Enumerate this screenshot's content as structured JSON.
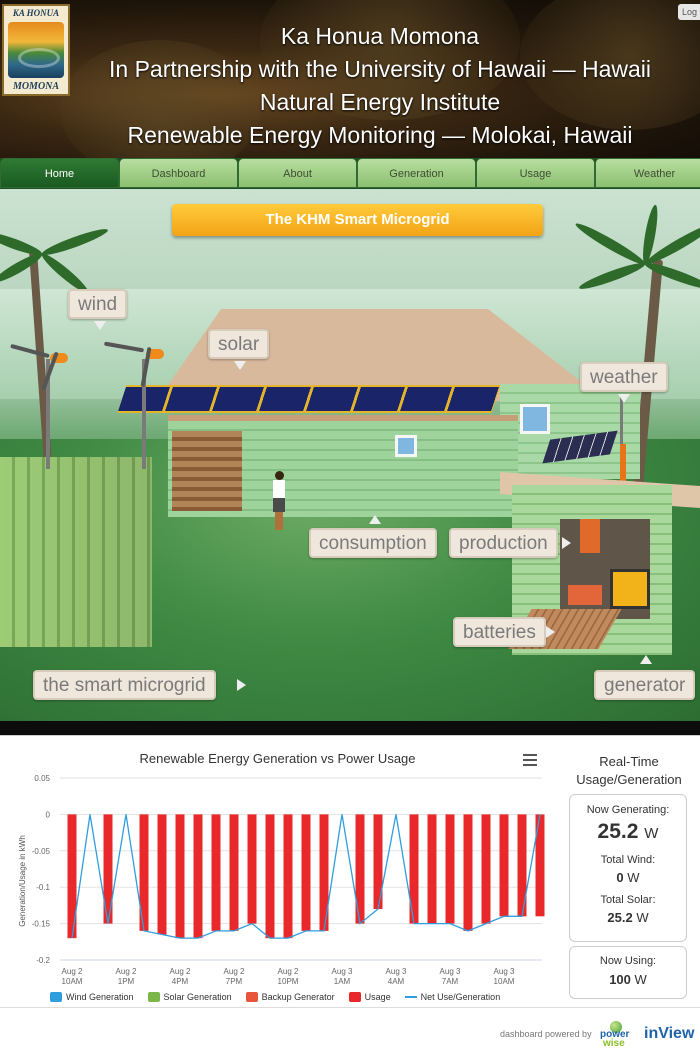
{
  "header": {
    "logo_top": "KA HONUA",
    "logo_bottom": "MOMONA",
    "lines": [
      "Ka Honua Momona",
      "In Partnership with the University of Hawaii — Hawaii",
      "Natural Energy Institute",
      "Renewable Energy Monitoring — Molokai, Hawaii"
    ],
    "login_label": "Log"
  },
  "nav": {
    "items": [
      "Home",
      "Dashboard",
      "About",
      "Generation",
      "Usage",
      "Weather"
    ],
    "active": "Home",
    "active_color": "#1f6a26",
    "inactive_color": "#a6d08c"
  },
  "scene": {
    "title": "The KHM Smart Microgrid",
    "tags": {
      "wind": "wind",
      "solar": "solar",
      "weather": "weather",
      "consumption": "consumption",
      "production": "production",
      "batteries": "batteries",
      "smart_microgrid": "the smart microgrid",
      "generator": "generator"
    }
  },
  "chart": {
    "title": "Renewable Energy Generation vs Power Usage",
    "menu_icon": "hamburger-menu-icon",
    "legend": [
      "Wind Generation",
      "Solar Generation",
      "Backup Generator",
      "Usage",
      "Net Use/Generation"
    ],
    "legend_colors": [
      "#2f9ede",
      "#7ab648",
      "#e8553a",
      "#e8282a",
      "#2f9ede"
    ]
  },
  "chart_data": {
    "type": "bar",
    "title": "Renewable Energy Generation vs Power Usage",
    "xlabel": "",
    "ylabel": "Generation/Usage in kWh",
    "ylim": [
      -0.2,
      0.05
    ],
    "yticks": [
      0.05,
      0,
      -0.05,
      -0.1,
      -0.15,
      -0.2
    ],
    "ytick_labels": [
      "0.05",
      "0",
      "-0.05",
      "-0.1",
      "-0.15",
      "-0.2"
    ],
    "xtick_labels": [
      [
        "Aug 2",
        "10AM"
      ],
      [
        "Aug 2",
        "1PM"
      ],
      [
        "Aug 2",
        "4PM"
      ],
      [
        "Aug 2",
        "7PM"
      ],
      [
        "Aug 2",
        "10PM"
      ],
      [
        "Aug 3",
        "1AM"
      ],
      [
        "Aug 3",
        "4AM"
      ],
      [
        "Aug 3",
        "7AM"
      ],
      [
        "Aug 3",
        "10AM"
      ]
    ],
    "xtick_positions": [
      0,
      3,
      6,
      9,
      12,
      15,
      18,
      21,
      24
    ],
    "grid": true,
    "legend_position": "bottom",
    "series": [
      {
        "name": "Usage",
        "color": "#e8282a",
        "values": [
          -0.17,
          0,
          -0.15,
          0,
          -0.16,
          -0.165,
          -0.17,
          -0.17,
          -0.16,
          -0.16,
          -0.15,
          -0.17,
          -0.17,
          -0.16,
          -0.16,
          0,
          -0.15,
          -0.13,
          0,
          -0.15,
          -0.15,
          -0.15,
          -0.16,
          -0.15,
          -0.14,
          -0.14,
          -0.14
        ]
      },
      {
        "name": "Net Use/Generation",
        "type": "line",
        "color": "#2f9ede",
        "values": [
          -0.17,
          0,
          -0.15,
          0,
          -0.16,
          -0.165,
          -0.17,
          -0.17,
          -0.16,
          -0.16,
          -0.15,
          -0.17,
          -0.17,
          -0.16,
          -0.16,
          0,
          -0.15,
          -0.13,
          0,
          -0.15,
          -0.15,
          -0.15,
          -0.16,
          -0.15,
          -0.14,
          -0.14,
          0
        ]
      }
    ]
  },
  "realtime": {
    "title_line1": "Real-Time",
    "title_line2": "Usage/Generation",
    "now_generating_label": "Now Generating:",
    "now_generating_value": "25.2",
    "unit_w": "W",
    "total_wind_label": "Total Wind:",
    "total_wind_value": "0",
    "total_solar_label": "Total Solar:",
    "total_solar_value": "25.2",
    "now_using_label": "Now Using:",
    "now_using_value": "100"
  },
  "footer": {
    "powered_by": "dashboard powered by",
    "power_word1": "power",
    "power_word2": "wise",
    "brand": "inView"
  }
}
